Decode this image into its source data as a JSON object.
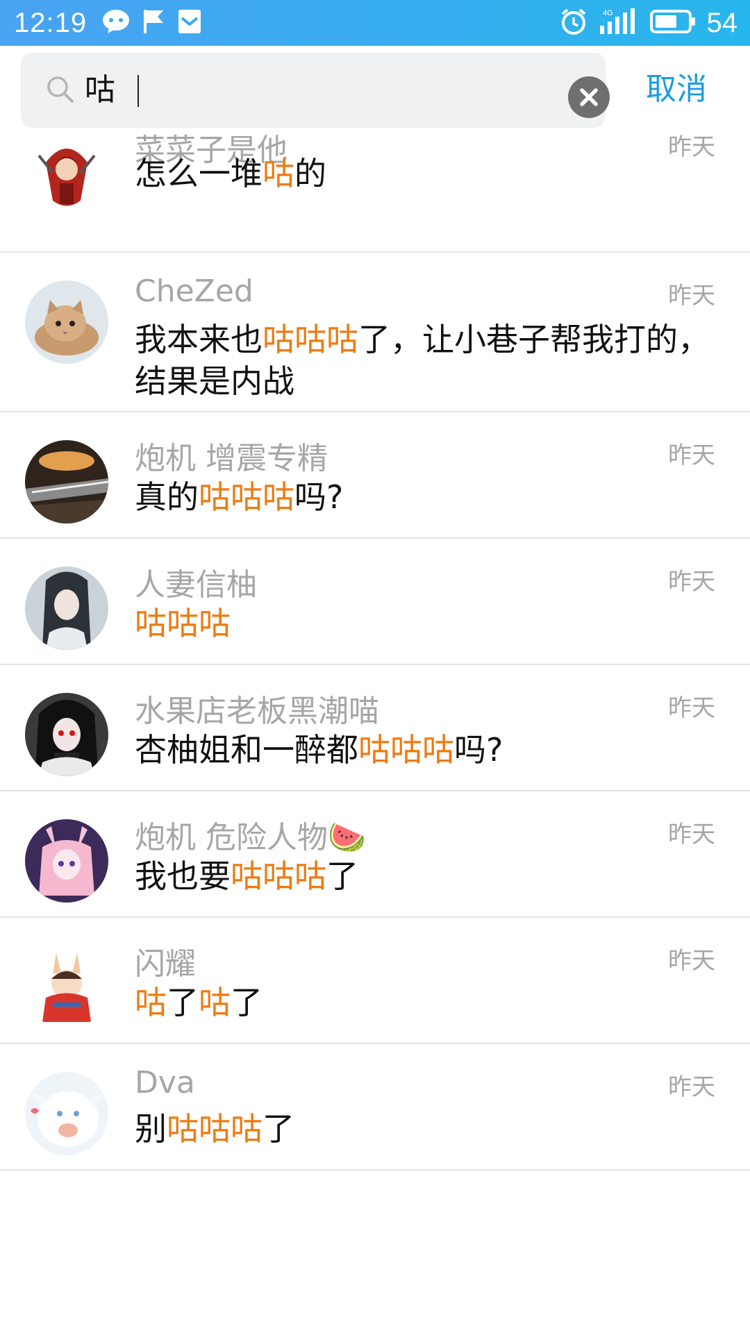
{
  "status_bar": {
    "time": "12:19",
    "network": "4G",
    "battery": "54"
  },
  "search": {
    "query": "咕",
    "cancel_label": "取消"
  },
  "colors": {
    "status_bar": "#3aa9f0",
    "highlight": "#ee7a10",
    "cancel": "#1c9be2",
    "secondary_text": "#a6a6a6"
  },
  "results": [
    {
      "name": "菜菜子是他",
      "time": "昨天",
      "message": [
        {
          "text": "怎么一堆",
          "hl": false
        },
        {
          "text": "咕",
          "hl": true
        },
        {
          "text": "的",
          "hl": false
        }
      ]
    },
    {
      "name": "CheZed",
      "time": "昨天",
      "message": [
        {
          "text": "我本来也",
          "hl": false
        },
        {
          "text": "咕咕咕",
          "hl": true
        },
        {
          "text": "了，让小巷子帮我打的，结果是内战",
          "hl": false
        }
      ]
    },
    {
      "name": "炮机 增震专精",
      "time": "昨天",
      "message": [
        {
          "text": "真的",
          "hl": false
        },
        {
          "text": "咕咕咕",
          "hl": true
        },
        {
          "text": "吗?",
          "hl": false
        }
      ]
    },
    {
      "name": "人妻信柚",
      "time": "昨天",
      "message": [
        {
          "text": "咕咕咕",
          "hl": true
        }
      ]
    },
    {
      "name": "水果店老板黑潮喵",
      "time": "昨天",
      "message": [
        {
          "text": "杏柚姐和一醉都",
          "hl": false
        },
        {
          "text": "咕咕咕",
          "hl": true
        },
        {
          "text": "吗?",
          "hl": false
        }
      ]
    },
    {
      "name": "炮机 危险人物🍉",
      "time": "昨天",
      "message": [
        {
          "text": "我也要",
          "hl": false
        },
        {
          "text": "咕咕咕",
          "hl": true
        },
        {
          "text": "了",
          "hl": false
        }
      ]
    },
    {
      "name": "闪耀",
      "time": "昨天",
      "message": [
        {
          "text": "咕",
          "hl": true
        },
        {
          "text": "了",
          "hl": false
        },
        {
          "text": "咕",
          "hl": true
        },
        {
          "text": "了",
          "hl": false
        }
      ]
    },
    {
      "name": "Dva",
      "time": "昨天",
      "message": [
        {
          "text": "别",
          "hl": false
        },
        {
          "text": "咕咕咕",
          "hl": true
        },
        {
          "text": "了",
          "hl": false
        }
      ]
    }
  ]
}
